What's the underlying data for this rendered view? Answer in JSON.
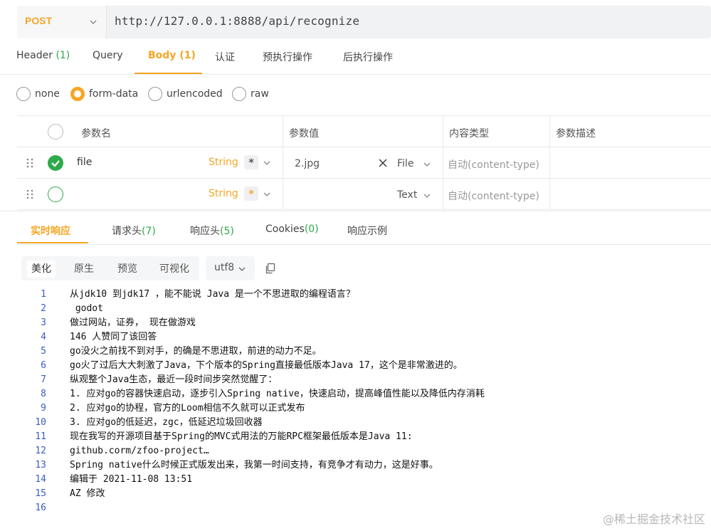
{
  "request": {
    "method": "POST",
    "url": "http://127.0.0.1:8888/api/recognize"
  },
  "req_tabs": [
    {
      "label": "Header",
      "count": "(1)"
    },
    {
      "label": "Query",
      "count": ""
    },
    {
      "label": "Body",
      "count": "(1)",
      "active": true
    },
    {
      "label": "认证",
      "count": ""
    },
    {
      "label": "预执行操作",
      "count": ""
    },
    {
      "label": "后执行操作",
      "count": ""
    }
  ],
  "body_modes": [
    {
      "label": "none",
      "checked": false
    },
    {
      "label": "form-data",
      "checked": true
    },
    {
      "label": "urlencoded",
      "checked": false
    },
    {
      "label": "raw",
      "checked": false
    }
  ],
  "params_table": {
    "headers": [
      "参数名",
      "参数值",
      "内容类型",
      "参数描述"
    ],
    "rows": [
      {
        "enabled": true,
        "name": "file",
        "type": "String",
        "required": "*",
        "value": "2.jpg",
        "value_type": "File",
        "content_type": "自动(content-type)",
        "description": ""
      },
      {
        "enabled": false,
        "name": "",
        "type": "String",
        "required": "*",
        "value": "",
        "value_type": "Text",
        "content_type": "自动(content-type)",
        "description": ""
      }
    ]
  },
  "resp_tabs": [
    {
      "label": "实时响应",
      "count": "",
      "active": true
    },
    {
      "label": "请求头",
      "count": "(7)"
    },
    {
      "label": "响应头",
      "count": "(5)"
    },
    {
      "label": "Cookies",
      "count": "(0)"
    },
    {
      "label": "响应示例",
      "count": ""
    }
  ],
  "view_tabs": [
    "美化",
    "原生",
    "预览",
    "可视化"
  ],
  "encoding": "utf8",
  "response_lines": [
    "从jdk10 到jdk17 ，能不能说 Java 是一个不思进取的编程语言？",
    " godot",
    "做过网站，证券， 现在做游戏",
    "146 人赞同了该回答",
    "go没火之前找不到对手，的确是不思进取，前进的动力不足。",
    "go火了过后大大刺激了Java，下个版本的Spring直接最低版本Java 17，这个是非常激进的。",
    "纵观整个Java生态，最近一段时间步突然觉醒了：",
    "1. 应对go的容器快速启动，逐步引入Spring native，快速启动，提高峰值性能以及降低内存消耗",
    "2. 应对go的协程，官方的Loom相信不久就可以正式发布",
    "3. 应对go的低延迟，zgc，低延迟垃圾回收器",
    "现在我写的开源项目基于Spring的MVC式用法的万能RPC框架最低版本是Java 11:",
    "github.corm/zfoo-project…",
    "Spring native什么时候正式版发出来，我第一时间支持，有竞争才有动力，这是好事。",
    "编辑于 2021-11-08 13:51",
    "AZ 修改",
    ""
  ],
  "watermark": "@稀土掘金技术社区",
  "colors": {
    "accent": "#f5a623",
    "success": "#2eaa4a",
    "line_number": "#3b5bc4"
  }
}
